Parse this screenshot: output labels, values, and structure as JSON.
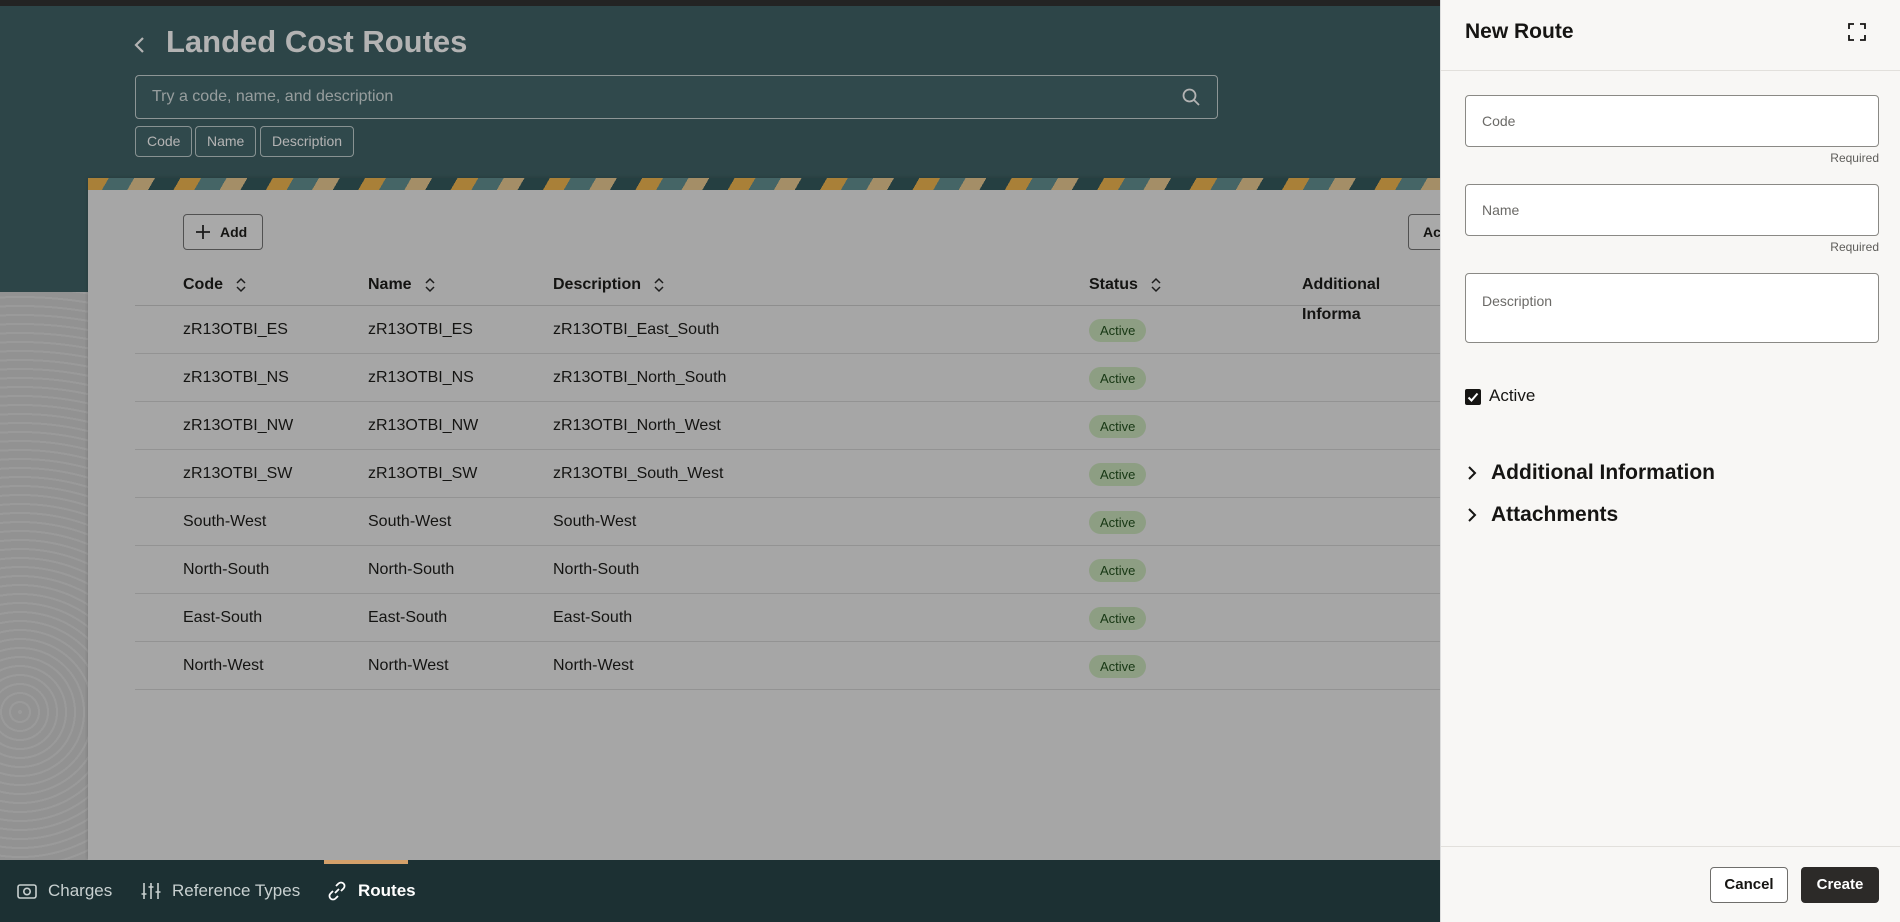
{
  "page": {
    "title": "Landed Cost Routes",
    "search_placeholder": "Try a code, name, and description",
    "filter_chips": [
      "Code",
      "Name",
      "Description"
    ]
  },
  "toolbar": {
    "add_label": "Add",
    "right_button_label": "Ac"
  },
  "table": {
    "columns": [
      "Code",
      "Name",
      "Description",
      "Status",
      "Additional Informa"
    ],
    "rows": [
      {
        "code": "zR13OTBI_ES",
        "name": "zR13OTBI_ES",
        "description": "zR13OTBI_East_South",
        "status": "Active"
      },
      {
        "code": "zR13OTBI_NS",
        "name": "zR13OTBI_NS",
        "description": "zR13OTBI_North_South",
        "status": "Active"
      },
      {
        "code": "zR13OTBI_NW",
        "name": "zR13OTBI_NW",
        "description": "zR13OTBI_North_West",
        "status": "Active"
      },
      {
        "code": "zR13OTBI_SW",
        "name": "zR13OTBI_SW",
        "description": "zR13OTBI_South_West",
        "status": "Active"
      },
      {
        "code": "South-West",
        "name": "South-West",
        "description": "South-West",
        "status": "Active"
      },
      {
        "code": "North-South",
        "name": "North-South",
        "description": "North-South",
        "status": "Active"
      },
      {
        "code": "East-South",
        "name": "East-South",
        "description": "East-South",
        "status": "Active"
      },
      {
        "code": "North-West",
        "name": "North-West",
        "description": "North-West",
        "status": "Active"
      }
    ]
  },
  "bottom_nav": {
    "items": [
      {
        "label": "Charges",
        "icon": "camera-icon"
      },
      {
        "label": "Reference Types",
        "icon": "sliders-icon"
      },
      {
        "label": "Routes",
        "icon": "link-icon",
        "active": true
      }
    ]
  },
  "drawer": {
    "title": "New Route",
    "fields": {
      "code": {
        "label": "Code",
        "value": "",
        "hint": "Required"
      },
      "name": {
        "label": "Name",
        "value": "",
        "hint": "Required"
      },
      "description": {
        "label": "Description",
        "value": ""
      }
    },
    "active": {
      "label": "Active",
      "checked": true
    },
    "sections": [
      "Additional Information",
      "Attachments"
    ],
    "cancel_label": "Cancel",
    "create_label": "Create"
  },
  "colors": {
    "header_teal": "#3a5e62",
    "nav_dark": "#1c3033",
    "badge_green": "#c7e0b8",
    "create_button": "#2c2a28"
  }
}
